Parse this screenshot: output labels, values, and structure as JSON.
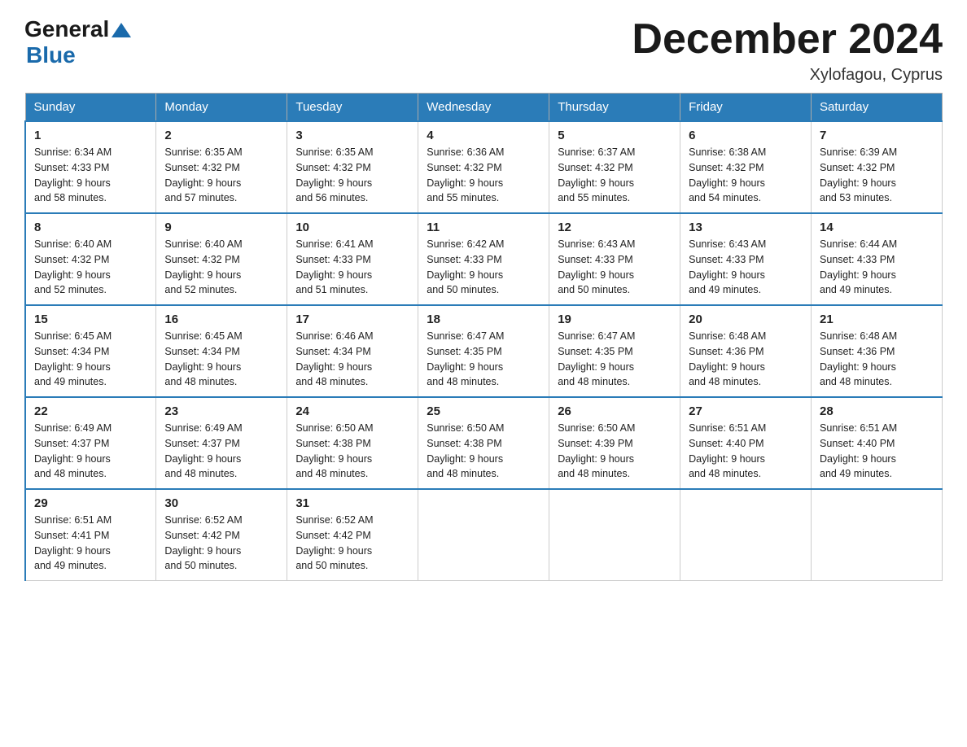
{
  "header": {
    "logo_general": "General",
    "logo_blue": "Blue",
    "month_title": "December 2024",
    "location": "Xylofagou, Cyprus"
  },
  "calendar": {
    "days_of_week": [
      "Sunday",
      "Monday",
      "Tuesday",
      "Wednesday",
      "Thursday",
      "Friday",
      "Saturday"
    ],
    "weeks": [
      [
        {
          "day": "1",
          "sunrise": "6:34 AM",
          "sunset": "4:33 PM",
          "daylight": "9 hours and 58 minutes."
        },
        {
          "day": "2",
          "sunrise": "6:35 AM",
          "sunset": "4:32 PM",
          "daylight": "9 hours and 57 minutes."
        },
        {
          "day": "3",
          "sunrise": "6:35 AM",
          "sunset": "4:32 PM",
          "daylight": "9 hours and 56 minutes."
        },
        {
          "day": "4",
          "sunrise": "6:36 AM",
          "sunset": "4:32 PM",
          "daylight": "9 hours and 55 minutes."
        },
        {
          "day": "5",
          "sunrise": "6:37 AM",
          "sunset": "4:32 PM",
          "daylight": "9 hours and 55 minutes."
        },
        {
          "day": "6",
          "sunrise": "6:38 AM",
          "sunset": "4:32 PM",
          "daylight": "9 hours and 54 minutes."
        },
        {
          "day": "7",
          "sunrise": "6:39 AM",
          "sunset": "4:32 PM",
          "daylight": "9 hours and 53 minutes."
        }
      ],
      [
        {
          "day": "8",
          "sunrise": "6:40 AM",
          "sunset": "4:32 PM",
          "daylight": "9 hours and 52 minutes."
        },
        {
          "day": "9",
          "sunrise": "6:40 AM",
          "sunset": "4:32 PM",
          "daylight": "9 hours and 52 minutes."
        },
        {
          "day": "10",
          "sunrise": "6:41 AM",
          "sunset": "4:33 PM",
          "daylight": "9 hours and 51 minutes."
        },
        {
          "day": "11",
          "sunrise": "6:42 AM",
          "sunset": "4:33 PM",
          "daylight": "9 hours and 50 minutes."
        },
        {
          "day": "12",
          "sunrise": "6:43 AM",
          "sunset": "4:33 PM",
          "daylight": "9 hours and 50 minutes."
        },
        {
          "day": "13",
          "sunrise": "6:43 AM",
          "sunset": "4:33 PM",
          "daylight": "9 hours and 49 minutes."
        },
        {
          "day": "14",
          "sunrise": "6:44 AM",
          "sunset": "4:33 PM",
          "daylight": "9 hours and 49 minutes."
        }
      ],
      [
        {
          "day": "15",
          "sunrise": "6:45 AM",
          "sunset": "4:34 PM",
          "daylight": "9 hours and 49 minutes."
        },
        {
          "day": "16",
          "sunrise": "6:45 AM",
          "sunset": "4:34 PM",
          "daylight": "9 hours and 48 minutes."
        },
        {
          "day": "17",
          "sunrise": "6:46 AM",
          "sunset": "4:34 PM",
          "daylight": "9 hours and 48 minutes."
        },
        {
          "day": "18",
          "sunrise": "6:47 AM",
          "sunset": "4:35 PM",
          "daylight": "9 hours and 48 minutes."
        },
        {
          "day": "19",
          "sunrise": "6:47 AM",
          "sunset": "4:35 PM",
          "daylight": "9 hours and 48 minutes."
        },
        {
          "day": "20",
          "sunrise": "6:48 AM",
          "sunset": "4:36 PM",
          "daylight": "9 hours and 48 minutes."
        },
        {
          "day": "21",
          "sunrise": "6:48 AM",
          "sunset": "4:36 PM",
          "daylight": "9 hours and 48 minutes."
        }
      ],
      [
        {
          "day": "22",
          "sunrise": "6:49 AM",
          "sunset": "4:37 PM",
          "daylight": "9 hours and 48 minutes."
        },
        {
          "day": "23",
          "sunrise": "6:49 AM",
          "sunset": "4:37 PM",
          "daylight": "9 hours and 48 minutes."
        },
        {
          "day": "24",
          "sunrise": "6:50 AM",
          "sunset": "4:38 PM",
          "daylight": "9 hours and 48 minutes."
        },
        {
          "day": "25",
          "sunrise": "6:50 AM",
          "sunset": "4:38 PM",
          "daylight": "9 hours and 48 minutes."
        },
        {
          "day": "26",
          "sunrise": "6:50 AM",
          "sunset": "4:39 PM",
          "daylight": "9 hours and 48 minutes."
        },
        {
          "day": "27",
          "sunrise": "6:51 AM",
          "sunset": "4:40 PM",
          "daylight": "9 hours and 48 minutes."
        },
        {
          "day": "28",
          "sunrise": "6:51 AM",
          "sunset": "4:40 PM",
          "daylight": "9 hours and 49 minutes."
        }
      ],
      [
        {
          "day": "29",
          "sunrise": "6:51 AM",
          "sunset": "4:41 PM",
          "daylight": "9 hours and 49 minutes."
        },
        {
          "day": "30",
          "sunrise": "6:52 AM",
          "sunset": "4:42 PM",
          "daylight": "9 hours and 50 minutes."
        },
        {
          "day": "31",
          "sunrise": "6:52 AM",
          "sunset": "4:42 PM",
          "daylight": "9 hours and 50 minutes."
        },
        null,
        null,
        null,
        null
      ]
    ]
  }
}
